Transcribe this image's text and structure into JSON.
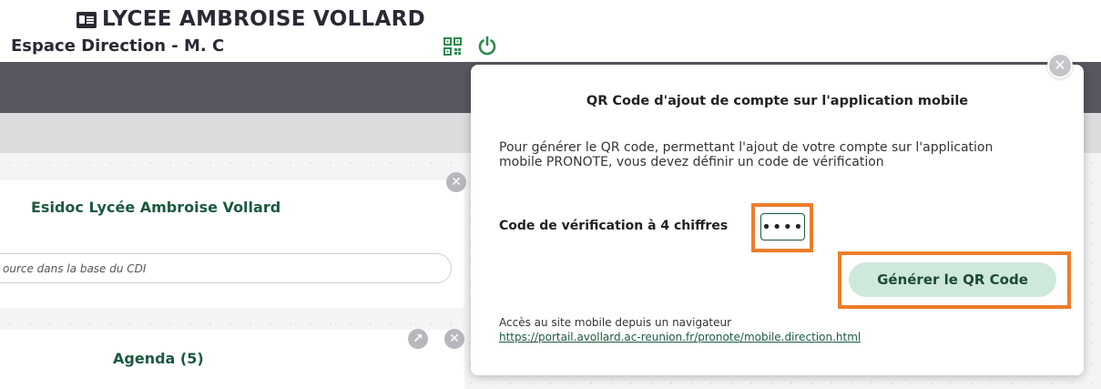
{
  "header": {
    "school_name": "LYCEE AMBROISE VOLLARD",
    "space_label": "Espace Direction - M. C",
    "icons": {
      "school": "id-card-icon",
      "qr": "qr-code-icon",
      "power": "power-icon"
    }
  },
  "widgets": {
    "esidoc": {
      "title": "Esidoc Lycée Ambroise Vollard",
      "search_placeholder": "ource dans la base du CDI"
    },
    "agenda": {
      "title": "Agenda (5)"
    }
  },
  "modal": {
    "title": "QR Code d'ajout de compte sur l'application mobile",
    "description": "Pour générer le QR code, permettant l'ajout de votre compte sur l'application mobile PRONOTE, vous devez définir un code de vérification",
    "code_label": "Code de vérification à 4 chiffres",
    "code_value": "••••",
    "generate_button": "Générer le QR Code",
    "mobile_access_label": "Accès au site mobile depuis un navigateur",
    "mobile_link": "https://portail.avollard.ac-reunion.fr/pronote/mobile.direction.html"
  },
  "colors": {
    "dark_bar": "#57575f",
    "light_bar": "#dcdcdf",
    "accent_green": "#1c5a3e",
    "button_green_bg": "#cfe8dc",
    "highlight_orange": "#ee7d2a"
  }
}
